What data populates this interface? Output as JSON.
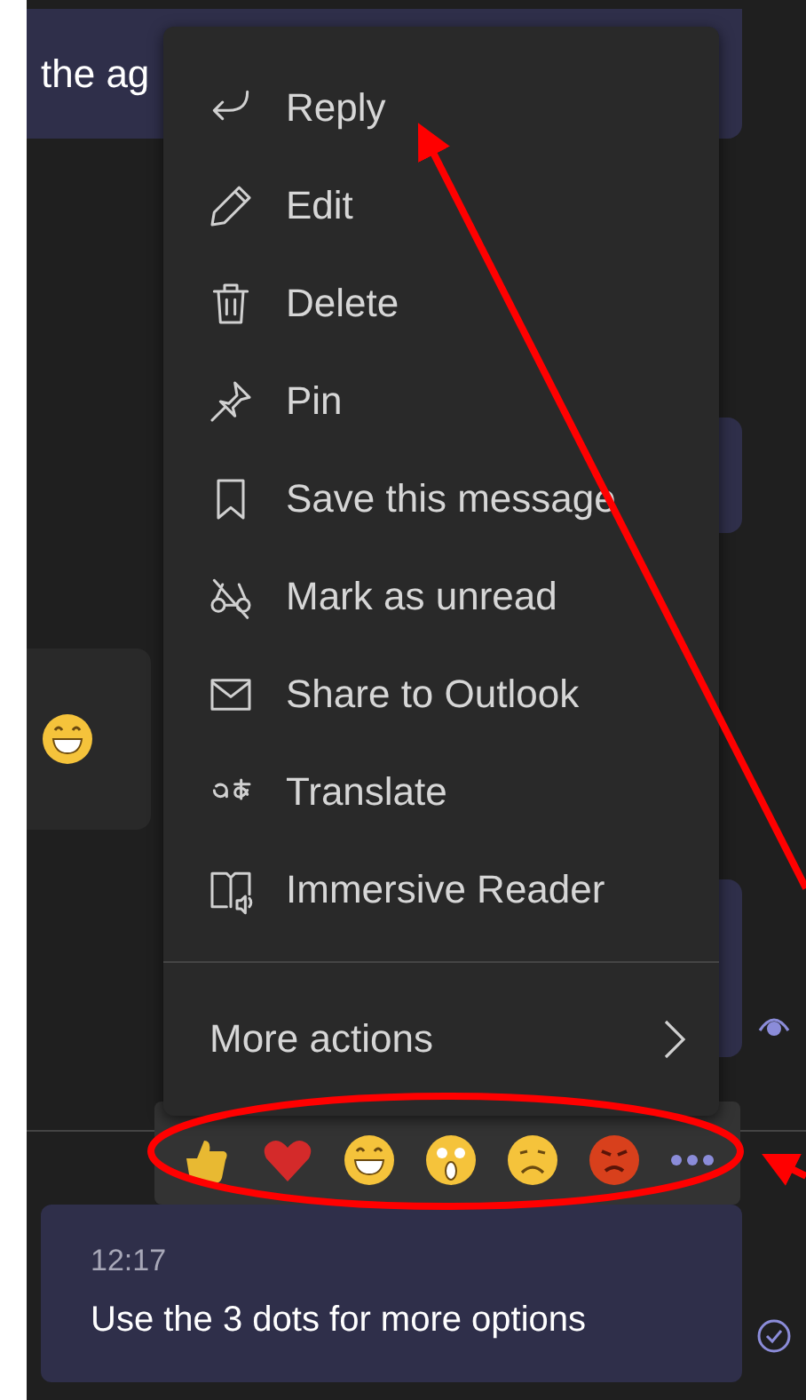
{
  "messages": [
    {
      "kind": "sent",
      "text": "the ag"
    },
    {
      "kind": "sent-hidden"
    },
    {
      "kind": "received"
    },
    {
      "kind": "sent-hidden"
    }
  ],
  "context_menu": {
    "items": [
      {
        "label": "Reply"
      },
      {
        "label": "Edit"
      },
      {
        "label": "Delete"
      },
      {
        "label": "Pin"
      },
      {
        "label": "Save this message"
      },
      {
        "label": "Mark as unread"
      },
      {
        "label": "Share to Outlook"
      },
      {
        "label": "Translate"
      },
      {
        "label": "Immersive Reader"
      }
    ],
    "more_actions": {
      "label": "More actions"
    }
  },
  "last_message": {
    "time": "12:17",
    "text": "Use the 3 dots for more options"
  }
}
